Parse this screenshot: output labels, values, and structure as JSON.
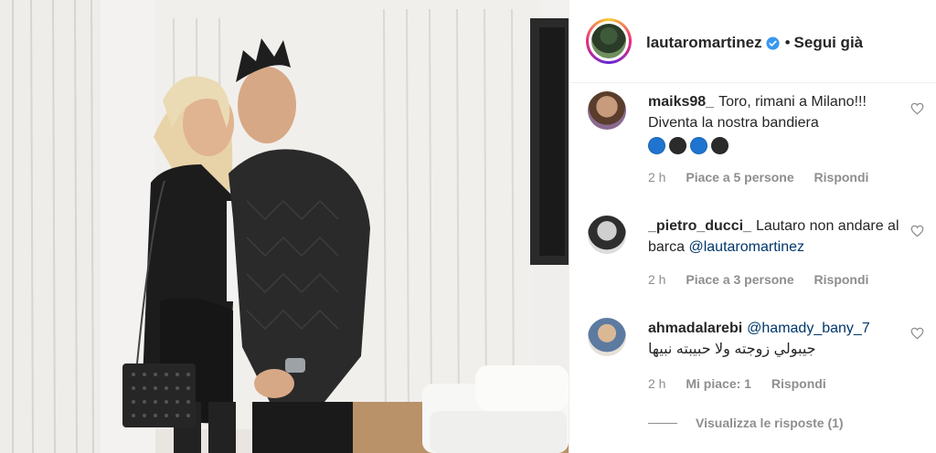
{
  "header": {
    "username": "lautaromartinez",
    "separator": "•",
    "follow_label": "Segui già"
  },
  "comments": [
    {
      "username": "maiks98_",
      "text": "Toro, rimani a Milano!!! Diventa la nostra bandiera",
      "emojis": [
        "blue-circle",
        "black-circle",
        "blue-circle",
        "black-circle"
      ],
      "time": "2 h",
      "likes": "Piace a 5 persone",
      "reply": "Rispondi"
    },
    {
      "username": "_pietro_ducci_",
      "text": "Lautaro non andare al barca ",
      "mention": "@lautaromartinez",
      "time": "2 h",
      "likes": "Piace a 3 persone",
      "reply": "Rispondi"
    },
    {
      "username": "ahmadalarebi",
      "mention": "@hamady_bany_7",
      "text": "جيبولي زوجته ولا حبيبته نبيها",
      "time": "2 h",
      "likes": "Mi piace: 1",
      "reply": "Rispondi",
      "view_replies": "Visualizza le risposte (1)"
    }
  ],
  "icons": {
    "verified": "verified-badge-icon",
    "heart": "heart-outline-icon"
  },
  "colors": {
    "verified_blue": "#3897f0",
    "meta_gray": "#8e8e8e",
    "text": "#262626",
    "mention": "#00376b"
  }
}
